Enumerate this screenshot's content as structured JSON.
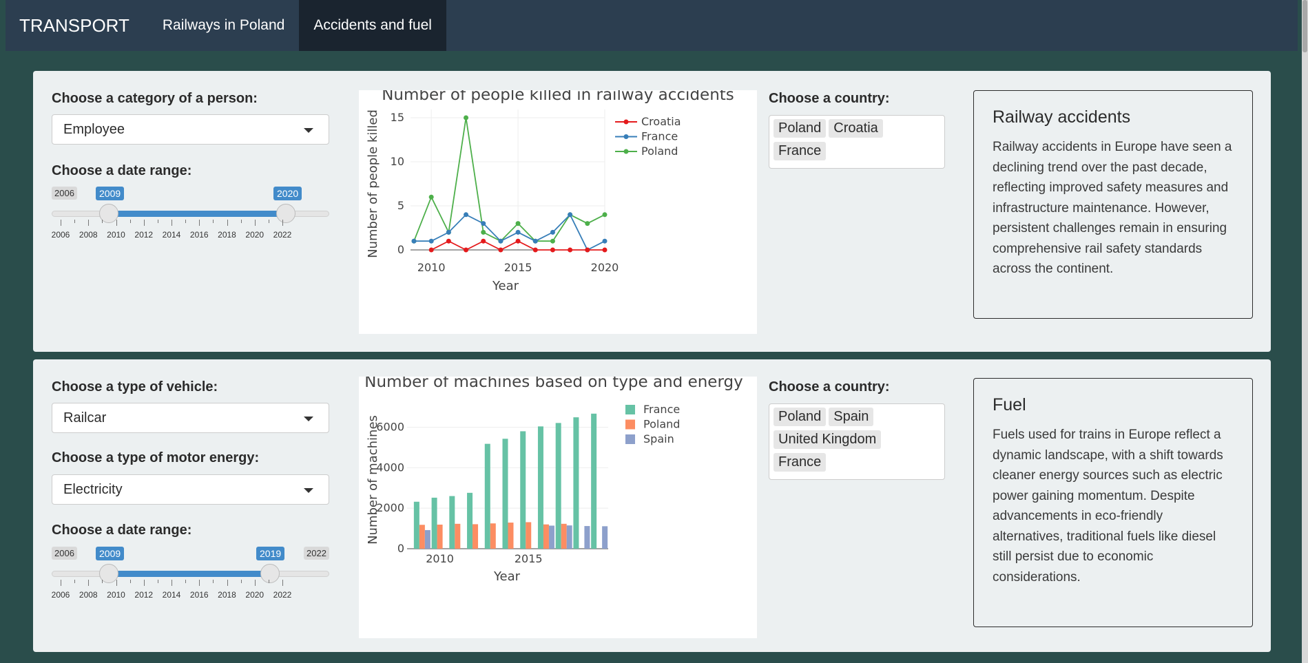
{
  "nav": {
    "brand": "TRANSPORT",
    "tabs": [
      {
        "label": "Railways in Poland",
        "active": false
      },
      {
        "label": "Accidents and fuel",
        "active": true
      }
    ]
  },
  "accidents": {
    "category_label": "Choose a category of a person:",
    "category_value": "Employee",
    "date_label": "Choose a date range:",
    "slider": {
      "min": 2006,
      "max": 2022,
      "from": 2009,
      "to": 2020,
      "min_label": "2006",
      "from_label": "2009",
      "to_label": "2020",
      "tick_labels": [
        "2006",
        "2008",
        "2010",
        "2012",
        "2014",
        "2016",
        "2018",
        "2020",
        "2022"
      ]
    },
    "country_label": "Choose a country:",
    "countries": [
      "Poland",
      "Croatia",
      "France"
    ],
    "info_title": "Railway accidents",
    "info_text": "Railway accidents in Europe have seen a declining trend over the past decade, reflecting improved safety measures and infrastructure maintenance. However, persistent challenges remain in ensuring comprehensive rail safety standards across the continent."
  },
  "fuel": {
    "vehicle_label": "Choose a type of vehicle:",
    "vehicle_value": "Railcar",
    "energy_label": "Choose a type of motor energy:",
    "energy_value": "Electricity",
    "date_label": "Choose a date range:",
    "slider": {
      "min": 2006,
      "max": 2022,
      "from": 2009,
      "to": 2019,
      "min_label": "2006",
      "max_label": "2022",
      "from_label": "2009",
      "to_label": "2019",
      "tick_labels": [
        "2006",
        "2008",
        "2010",
        "2012",
        "2014",
        "2016",
        "2018",
        "2020",
        "2022"
      ]
    },
    "country_label": "Choose a country:",
    "countries": [
      "Poland",
      "Spain",
      "United Kingdom",
      "France"
    ],
    "info_title": "Fuel",
    "info_text": "Fuels used for trains in Europe reflect a dynamic landscape, with a shift towards cleaner energy sources such as electric power gaining momentum. Despite advancements in eco-friendly alternatives, traditional fuels like diesel still persist due to economic considerations."
  },
  "chart_data": [
    {
      "type": "line",
      "title": "Number of people killed in railway accidents",
      "xlabel": "Year",
      "ylabel": "Number of people killed",
      "xlim": [
        2009,
        2020
      ],
      "ylim": [
        0,
        15
      ],
      "x_ticks": [
        "2010",
        "2015",
        "2020"
      ],
      "y_ticks": [
        "0",
        "5",
        "10",
        "15"
      ],
      "legend": "top-right",
      "grid": true,
      "x": [
        2009,
        2010,
        2011,
        2012,
        2013,
        2014,
        2015,
        2016,
        2017,
        2018,
        2019,
        2020
      ],
      "series": [
        {
          "name": "Croatia",
          "color": "#e41a1c",
          "values": [
            null,
            0,
            1,
            0,
            1,
            0,
            1,
            0,
            0,
            0,
            0,
            0
          ]
        },
        {
          "name": "France",
          "color": "#377eb8",
          "values": [
            1,
            1,
            2,
            4,
            3,
            1,
            2,
            1,
            2,
            4,
            0,
            1
          ]
        },
        {
          "name": "Poland",
          "color": "#4daf4a",
          "values": [
            1,
            6,
            2,
            15,
            2,
            1,
            3,
            1,
            1,
            4,
            3,
            4
          ]
        }
      ]
    },
    {
      "type": "bar",
      "title": "Number of machines based on type and energy",
      "xlabel": "Year",
      "ylabel": "Number of machines",
      "ylim": [
        0,
        6800
      ],
      "x_ticks": [
        "2010",
        "2015"
      ],
      "y_ticks": [
        "0",
        "2000",
        "4000",
        "6000"
      ],
      "legend": "top-right",
      "grid": true,
      "categories": [
        2009,
        2010,
        2011,
        2012,
        2013,
        2014,
        2015,
        2016,
        2017,
        2018,
        2019
      ],
      "series": [
        {
          "name": "France",
          "color": "#66c2a5",
          "values": [
            2320,
            2520,
            2600,
            2760,
            5180,
            5430,
            5800,
            6040,
            6210,
            6490,
            6670
          ]
        },
        {
          "name": "Poland",
          "color": "#fc8d62",
          "values": [
            1180,
            1190,
            1230,
            1210,
            1250,
            1290,
            1310,
            1200,
            1230,
            null,
            null
          ]
        },
        {
          "name": "Spain",
          "color": "#8da0cb",
          "values": [
            920,
            null,
            null,
            null,
            null,
            null,
            null,
            1140,
            1150,
            1120,
            1110
          ]
        }
      ]
    }
  ]
}
